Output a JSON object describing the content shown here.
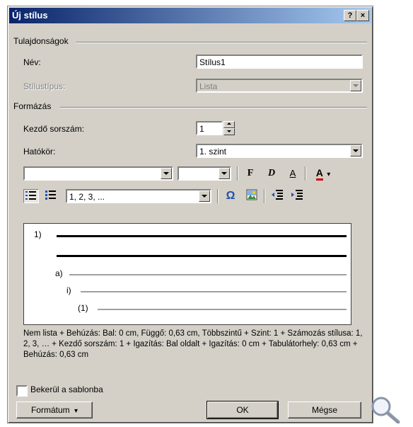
{
  "window": {
    "title": "Új stílus",
    "help_glyph": "?",
    "close_glyph": "×"
  },
  "properties": {
    "group_label": "Tulajdonságok",
    "name_label": "Név:",
    "name_value": "Stílus1",
    "style_type_label": "Stílustípus:",
    "style_type_value": "Lista"
  },
  "formatting": {
    "group_label": "Formázás",
    "start_at_label": "Kezdő sorszám:",
    "start_at_value": "1",
    "scope_label": "Hatókör:",
    "scope_value": "1. szint",
    "font_value": "",
    "size_value": "",
    "bold_glyph": "F",
    "italic_glyph": "D",
    "underline_glyph": "A",
    "font_color_glyph": "A",
    "font_color": "#d00000",
    "numbering_format_value": "1, 2, 3, ...",
    "symbol_glyph": "Ω",
    "icons": [
      "numbered-list-icon",
      "bulleted-list-icon",
      "omega-symbol-icon",
      "picture-icon",
      "decrease-indent-icon",
      "increase-indent-icon"
    ]
  },
  "preview": {
    "labels": [
      "1)",
      "a)",
      "i)",
      "(1)"
    ]
  },
  "description": "Nem lista + Behúzás: Bal:  0 cm, Függő:  0,63 cm, Többszintű + Szint: 1 + Számozás stílusa: 1, 2, 3, … + Kezdő sorszám: 1 + Igazítás: Bal oldalt + Igazítás:  0 cm + Tabulátorhely: 0,63 cm + Behúzás:  0,63 cm",
  "template_checkbox": {
    "label": "Bekerül a sablonba",
    "checked": false
  },
  "buttons": {
    "format": "Formátum",
    "format_arrow": "▾",
    "ok": "OK",
    "cancel": "Mégse"
  }
}
